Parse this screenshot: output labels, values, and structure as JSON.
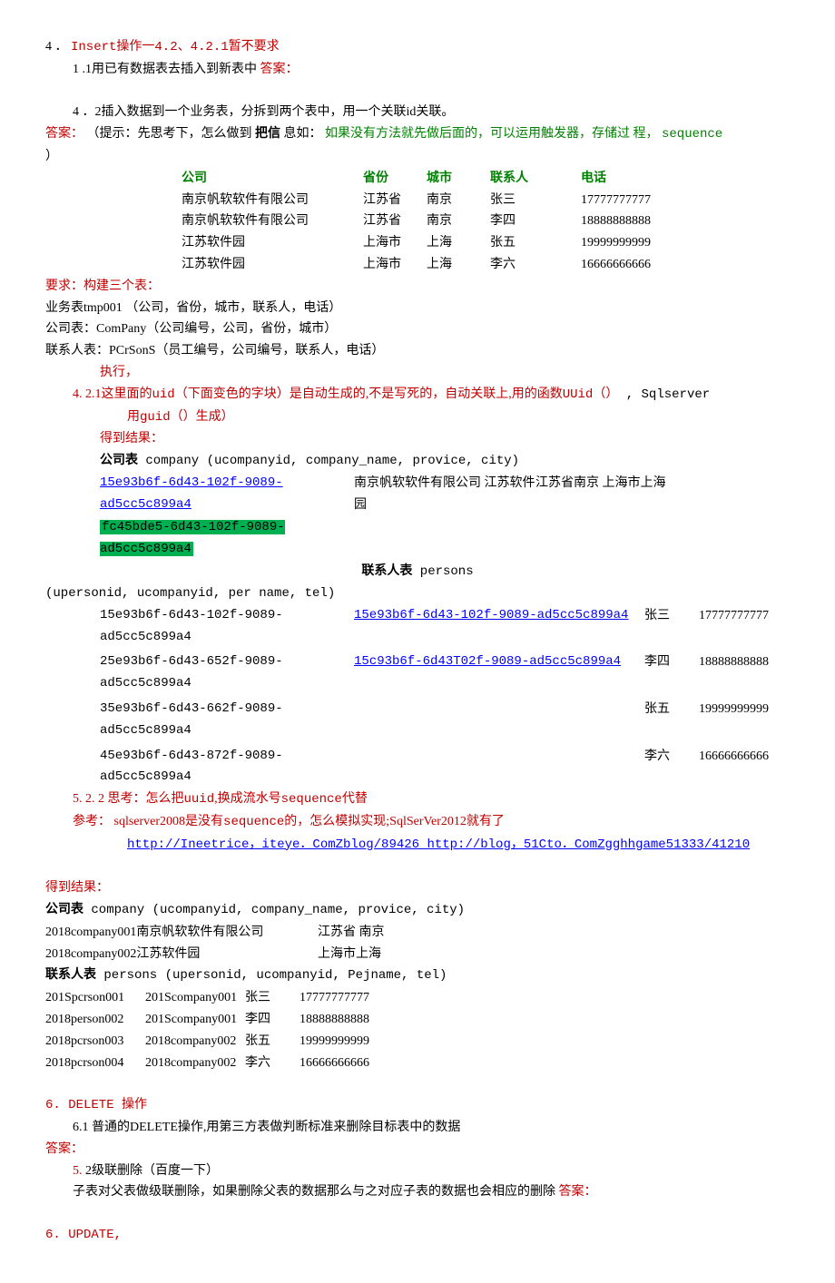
{
  "s4": {
    "title_prefix": "4 ．",
    "title_red": "Insert操作一4.2、4.2.1暂不要求",
    "line1": "1 .1用已有数据表去插入到新表中 ",
    "line1_ans": "答案：",
    "line2": "4 ．2插入数据到一个业务表，分拆到两个表中，用一个关联id关联。",
    "ans_label": "答案：",
    "hint_black": "（提示：先思考下，怎么做到 ",
    "hint_bold": "把信",
    "hint_black2": "息如：",
    "hint_green": "如果没有方法就先做后面的，可以运用触发器，存储过 程，",
    "hint_mono": "sequence",
    "hint_paren": "）"
  },
  "table": {
    "h1": "公司",
    "h2": "省份",
    "h3": "城市",
    "h4": "联系人",
    "h5": "电话",
    "rows": [
      [
        "南京帆软软件有限公司",
        "江苏省",
        "南京",
        "张三",
        "17777777777"
      ],
      [
        "南京帆软软件有限公司",
        "江苏省",
        "南京",
        "李四",
        "18888888888"
      ],
      [
        "江苏软件园",
        "上海市",
        "上海",
        "张五",
        "19999999999"
      ],
      [
        "江苏软件园",
        "上海市",
        "上海",
        "李六",
        "16666666666"
      ]
    ]
  },
  "req": {
    "title": "要求：构建三个表：",
    "t1": "业务表tmp001 （公司，省份，城市，联系人，电话）",
    "t2": "公司表：ComPany（公司编号，公司，省份，城市）",
    "t3": "联系人表：PCrSonS（员工编号，公司编号，联系人，电话）",
    "exec": "执行，"
  },
  "s421": {
    "num": "4. 2.1",
    "p1": "这里面的",
    "p2": "uid",
    "p3": "（下面变色的字块）是自动生成的,不是写死的，自动关联上,用的函数",
    "p4": "UUid（）",
    "p5": " , Sqlserver",
    "p6": "用",
    "p7": "guid（）",
    "p8": "生成）",
    "result": "得到结果：",
    "company_hdr": "公司表",
    "company_sig": " company (ucompanyid, company_name, provice, city)",
    "uuid1": "15e93b6f-6d43-102f-9089-ad5cc5c899a4",
    "uuid2": "fc45bde5-6d43-102f-9089-ad5cc5c899a4",
    "comp_name": "南京帆软软件有限公司 江苏软件园",
    "comp_loc": "江苏省南京 上海市上海",
    "persons_hdr": "联系人表",
    "persons_mono": " persons",
    "persons_sig": "(upersonid, ucompanyid, per name, tel)",
    "prows": [
      {
        "a": "15e93b6f-6d43-102f-9089-ad5cc5c899a4",
        "b": "15e93b6f-6d43-102f-9089-ad5cc5c899a4",
        "c": "张三",
        "d": "17777777777",
        "blink": "blue"
      },
      {
        "a": "25e93b6f-6d43-652f-9089-ad5cc5c899a4",
        "b": "15c93b6f-6d43T02f-9089-ad5cc5c899a4",
        "c": "李四",
        "d": "18888888888",
        "blink": "blue"
      },
      {
        "a": "35e93b6f-6d43-662f-9089-ad5cc5c899a4",
        "b": "",
        "c": "张五",
        "d": "19999999999",
        "blink": ""
      },
      {
        "a": "45e93b6f-6d43-872f-9089-ad5cc5c899a4",
        "b": "",
        "c": "李六",
        "d": "16666666666",
        "blink": ""
      }
    ]
  },
  "s522": {
    "num": "5. 2. 2",
    "p1": "思考：怎么把",
    "p2": "uuid",
    "p3": ",换成流水号",
    "p4": "sequence",
    "p5": "代替",
    "ref": "参考：",
    "ref_red1": "sqlserver2008是没有",
    "ref_mono": "sequence",
    "ref_red2": "的，怎么模拟实现;SqlSerVer2012就有了",
    "link": "http://Ineetrice，iteye．ComZblog/89426 http://blog，51Cto．ComZgghhgame51333/41210"
  },
  "result2": {
    "title": "得到结果：",
    "company_hdr": "公司表",
    "company_sig": " company (ucompanyid, company_name, provice, city)",
    "crows": [
      [
        "2018company001南京帆软软件有限公司",
        "江苏省 南京"
      ],
      [
        "2018company002江苏软件园",
        "上海市上海"
      ]
    ],
    "persons_hdr": "联系人表",
    "persons_sig": " persons (upersonid, ucompanyid, Pejname, tel)",
    "prows": [
      [
        "201Spcrson001",
        "201Scompany001",
        "张三",
        "17777777777"
      ],
      [
        "2018person002",
        "201Scompany001",
        "李四",
        "18888888888"
      ],
      [
        "2018pcrson003",
        "2018company002",
        "张五",
        "19999999999"
      ],
      [
        "2018pcrson004",
        "2018company002",
        "李六",
        "16666666666"
      ]
    ]
  },
  "s6": {
    "title": "6.  DELETE 操作",
    "l1": "6.1  普通的DELETE操作,用第三方表做判断标准来删除目标表中的数据",
    "ans": "答案：",
    "l2num": "5.",
    "l2": "2级联删除（百度一下）",
    "l3": "子表对父表做级联删除，如果删除父表的数据那么与之对应子表的数据也会相应的删除 ",
    "l3ans": "答案："
  },
  "s6b": {
    "title": "6.  UPDATE,"
  }
}
